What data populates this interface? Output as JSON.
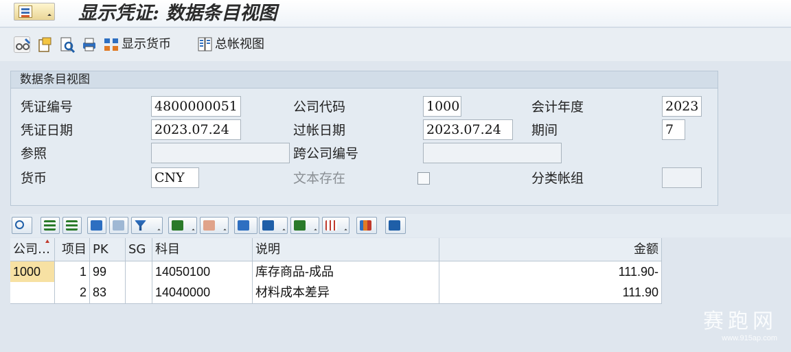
{
  "window": {
    "title": "显示凭证: 数据条目视图"
  },
  "toolbar": {
    "display_currency": "显示货币",
    "gl_view": "总帐视图"
  },
  "header": {
    "group_title": "数据条目视图",
    "doc_no_label": "凭证编号",
    "doc_no": "4800000051",
    "company_label": "公司代码",
    "company": "1000",
    "fiscal_year_label": "会计年度",
    "fiscal_year": "2023",
    "doc_date_label": "凭证日期",
    "doc_date": "2023.07.24",
    "post_date_label": "过帐日期",
    "post_date": "2023.07.24",
    "period_label": "期间",
    "period": "7",
    "ref_label": "参照",
    "ref": "",
    "cross_co_label": "跨公司编号",
    "cross_co": "",
    "currency_label": "货币",
    "currency": "CNY",
    "text_exists_label": "文本存在",
    "ledger_group_label": "分类帐组",
    "ledger_group": ""
  },
  "table": {
    "columns": [
      "公司…",
      "项目",
      "PK",
      "SG",
      "科目",
      "说明",
      "金额"
    ],
    "rows": [
      [
        "1000",
        "1",
        "99",
        "",
        "14050100",
        "库存商品-成品",
        "111.90-"
      ],
      [
        "",
        "2",
        "83",
        "",
        "14040000",
        "材料成本差异",
        "111.90"
      ]
    ]
  },
  "watermark": {
    "text": "赛跑网",
    "url": "www.915ap.com"
  },
  "colors": {
    "accent": "#f7e1a3",
    "background": "#dfe6ee"
  }
}
